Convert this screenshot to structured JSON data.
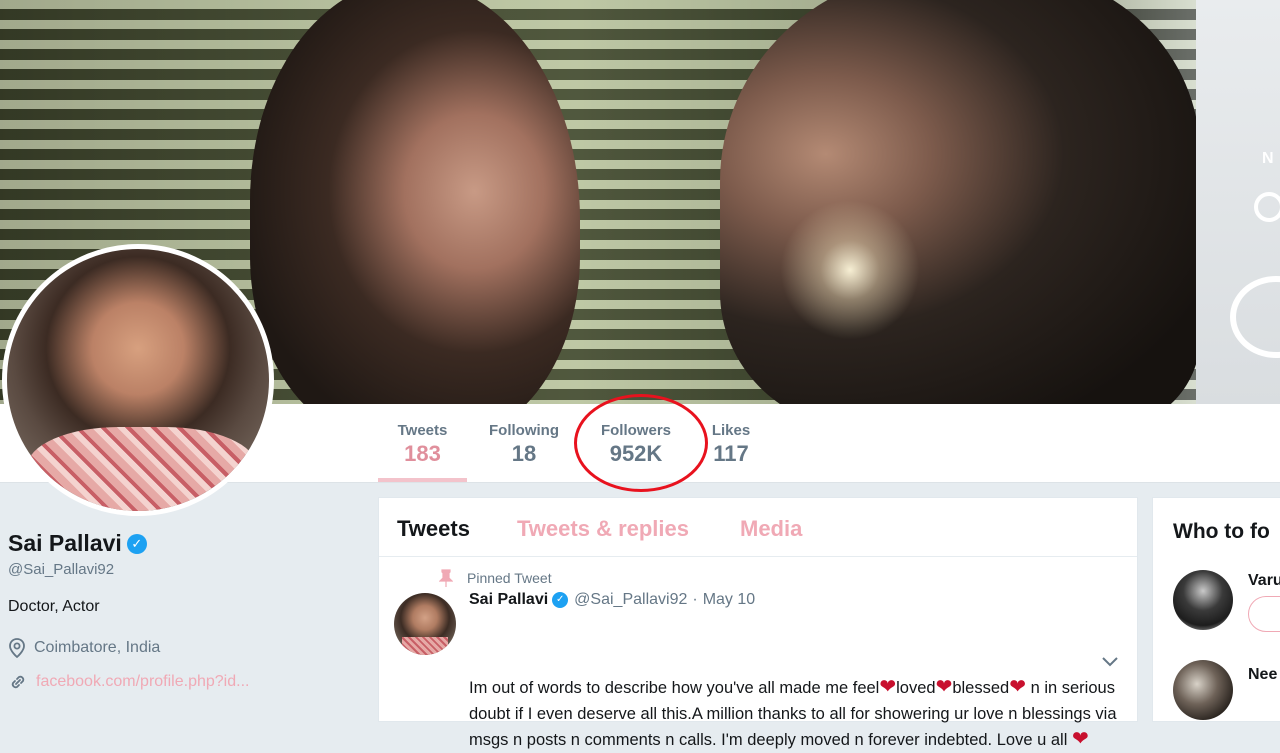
{
  "profile": {
    "name": "Sai Pallavi",
    "handle": "@Sai_Pallavi92",
    "bio": "Doctor, Actor",
    "location": "Coimbatore, India",
    "website": "facebook.com/profile.php?id..."
  },
  "stats": [
    {
      "label": "Tweets",
      "value": "183"
    },
    {
      "label": "Following",
      "value": "18"
    },
    {
      "label": "Followers",
      "value": "952K"
    },
    {
      "label": "Likes",
      "value": "117"
    }
  ],
  "tabs": [
    "Tweets",
    "Tweets & replies",
    "Media"
  ],
  "tweet": {
    "pinned_label": "Pinned Tweet",
    "author": "Sai Pallavi",
    "handle": "@Sai_Pallavi92",
    "separator": "·",
    "date": "May 10",
    "text_parts": [
      "Im out of words to describe how you've all made me feel",
      "loved",
      "blessed",
      " n in serious doubt if I even deserve all this.A million thanks to all for showering ur love n blessings via msgs n posts n comments n calls. I'm deeply moved n forever indebted. Love u all"
    ]
  },
  "who_to_follow": {
    "title": "Who to fo",
    "users": [
      {
        "name": "Varu"
      },
      {
        "name": "Nee"
      }
    ]
  },
  "colors": {
    "accent": "#f0a9b5",
    "accent_dark": "#e08f9c",
    "verified": "#1da1f2",
    "annotation": "#e8121e",
    "heart": "#c8102e"
  }
}
